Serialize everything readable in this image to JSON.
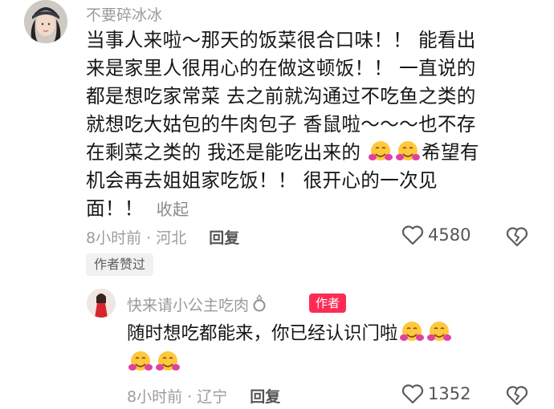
{
  "comment": {
    "username": "不要碎冰冰",
    "text_lines": [
      "当事人来啦～那天的饭菜很合口味！！ 能看出",
      "来是家里人很用心的在做这顿饭！！ 一直说的",
      "都是想吃家常菜 去之前就沟通过不吃鱼之类的",
      "就想吃大姑包的牛肉包子 香鼠啦～～～也不存",
      "在剩菜之类的 我还是能吃出来的",
      "希望有",
      "机会再去姐姐家吃饭！！ 很开心的一次见",
      "面！！"
    ],
    "collapse_label": "收起",
    "time_location": "8小时前 · 河北",
    "reply_label": "回复",
    "like_count": "4580",
    "author_liked_label": "作者赞过"
  },
  "reply": {
    "username": "快来请小公主吃肉",
    "author_badge": "作者",
    "text": "随时想吃都能来，你已经认识门啦",
    "time_location": "8小时前 · 辽宁",
    "reply_label": "回复",
    "like_count": "1352"
  },
  "colors": {
    "accent": "#fe2c55",
    "muted_text": "#9c9c9c",
    "body_text": "#161616",
    "badge_bg": "#f1f1f1"
  },
  "icons": {
    "like": "heart-outline-icon",
    "dislike": "broken-heart-icon",
    "emoji": "hugging-face-emoji",
    "ring": "diamond-ring-icon"
  }
}
